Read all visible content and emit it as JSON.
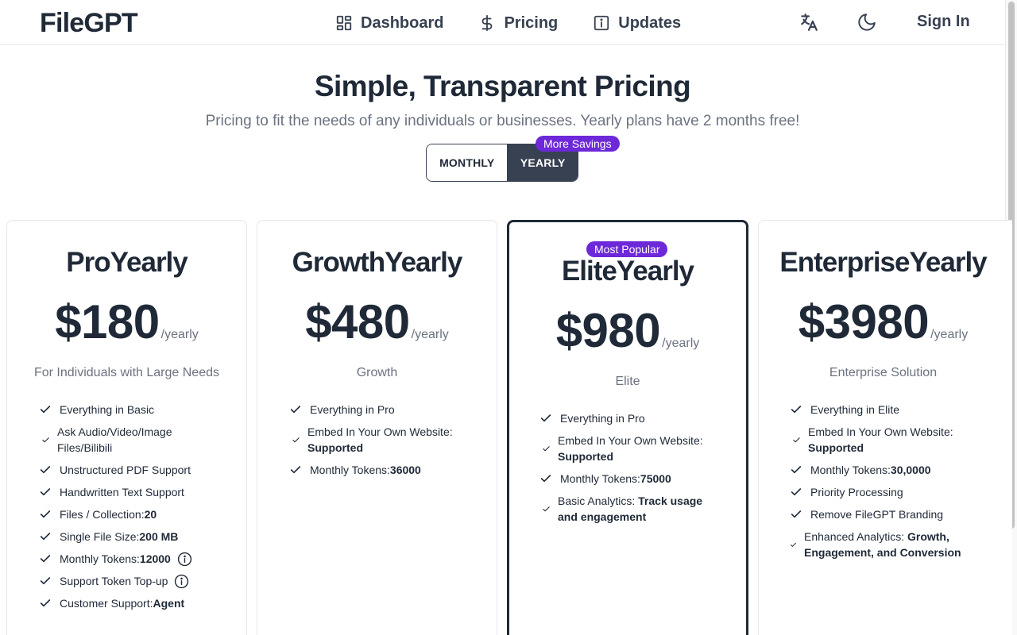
{
  "header": {
    "logo": "FileGPT",
    "nav": [
      {
        "label": "Dashboard",
        "icon": "dashboard-grid-icon"
      },
      {
        "label": "Pricing",
        "icon": "dollar-icon"
      },
      {
        "label": "Updates",
        "icon": "info-square-icon"
      }
    ],
    "translate_icon": "translate-icon",
    "theme_icon": "moon-icon",
    "sign_in": "Sign In"
  },
  "hero": {
    "title": "Simple, Transparent Pricing",
    "subtitle": "Pricing to fit the needs of any individuals or businesses. Yearly plans have 2 months free!",
    "toggle": {
      "monthly": "MONTHLY",
      "yearly": "YEARLY",
      "selected": "YEARLY"
    },
    "savings_badge": "More Savings"
  },
  "colors": {
    "accent": "#6d28d9",
    "dark": "#1f2937",
    "muted": "#6b7280"
  },
  "plans": [
    {
      "title": "ProYearly",
      "price": "$180",
      "period": "/yearly",
      "description": "For Individuals with Large Needs",
      "features": [
        {
          "label": "Everything in Basic",
          "value": ""
        },
        {
          "label": "Ask Audio/Video/Image Files/Bilibili",
          "value": ""
        },
        {
          "label": "Unstructured PDF Support",
          "value": ""
        },
        {
          "label": "Handwritten Text Support",
          "value": ""
        },
        {
          "label": "Files / Collection: ",
          "value": "20"
        },
        {
          "label": "Single File Size: ",
          "value": "200 MB"
        },
        {
          "label": "Monthly Tokens: ",
          "value": "12000",
          "info": true
        },
        {
          "label": "Support Token Top-up",
          "value": "",
          "info": true
        },
        {
          "label": "Customer Support: ",
          "value": "Agent"
        }
      ]
    },
    {
      "title": "GrowthYearly",
      "price": "$480",
      "period": "/yearly",
      "description": "Growth",
      "features": [
        {
          "label": "Everything in Pro",
          "value": ""
        },
        {
          "label": "Embed In Your Own Website: ",
          "value": "Supported"
        },
        {
          "label": "Monthly Tokens: ",
          "value": "36000"
        }
      ]
    },
    {
      "title": "EliteYearly",
      "badge": "Most Popular",
      "price": "$980",
      "period": "/yearly",
      "description": "Elite",
      "features": [
        {
          "label": "Everything in Pro",
          "value": ""
        },
        {
          "label": "Embed In Your Own Website: ",
          "value": "Supported"
        },
        {
          "label": "Monthly Tokens: ",
          "value": "75000"
        },
        {
          "label": "Basic Analytics: ",
          "value": "Track usage and engagement"
        }
      ]
    },
    {
      "title": "EnterpriseYearly",
      "price": "$3980",
      "period": "/yearly",
      "description": "Enterprise Solution",
      "features": [
        {
          "label": "Everything in Elite",
          "value": ""
        },
        {
          "label": "Embed In Your Own Website: ",
          "value": "Supported"
        },
        {
          "label": "Monthly Tokens: ",
          "value": "30,0000"
        },
        {
          "label": "Priority Processing",
          "value": ""
        },
        {
          "label": "Remove FileGPT Branding",
          "value": ""
        },
        {
          "label": "Enhanced Analytics: ",
          "value": "Growth, Engagement, and Conversion"
        }
      ]
    }
  ]
}
